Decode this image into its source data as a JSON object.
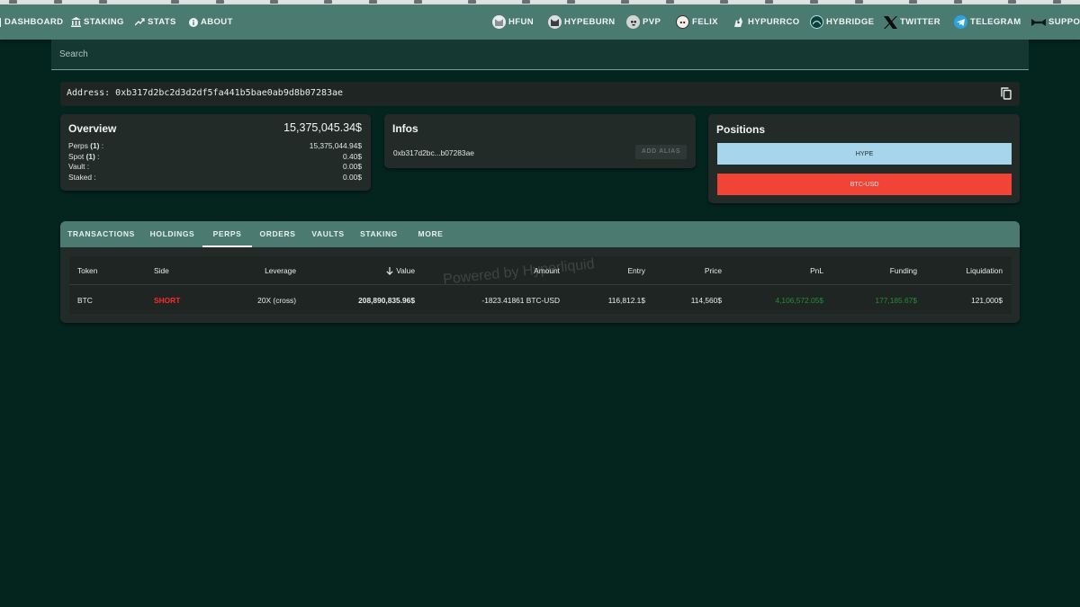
{
  "nav": {
    "left": [
      {
        "label": "DASHBOARD",
        "icon": "dashboard-icon"
      },
      {
        "label": "STAKING",
        "icon": "bank-icon"
      },
      {
        "label": "STATS",
        "icon": "trending-up-icon"
      },
      {
        "label": "ABOUT",
        "icon": "info-icon"
      }
    ],
    "right": [
      {
        "label": "HFUN",
        "icon": "cat-logo-icon"
      },
      {
        "label": "HYPEBURN",
        "icon": "cat-fire-icon"
      },
      {
        "label": "PVP",
        "icon": "skull-icon"
      },
      {
        "label": "FELIX",
        "icon": "felix-logo-icon"
      },
      {
        "label": "HYPURRCO",
        "icon": "hypurr-logo-icon"
      },
      {
        "label": "HYBRIDGE",
        "icon": "bridge-logo-icon"
      },
      {
        "label": "TWITTER",
        "icon": "x-logo-icon"
      },
      {
        "label": "TELEGRAM",
        "icon": "telegram-icon"
      },
      {
        "label": "SUPPORT",
        "icon": "support-icon"
      }
    ]
  },
  "search": {
    "label": "Search"
  },
  "address": {
    "text": "Address: 0xb317d2bc2d3d2df5fa441b5bae0ab9d8b07283ae"
  },
  "overview": {
    "title": "Overview",
    "total": "15,375,045.34$",
    "rows": [
      {
        "label": "Perps",
        "count": "(1)",
        "suffix": " :",
        "value": "15,375,044.94$"
      },
      {
        "label": "Spot",
        "count": "(1)",
        "suffix": " :",
        "value": "0.40$"
      },
      {
        "label": "Vault :",
        "count": "",
        "suffix": "",
        "value": "0.00$"
      },
      {
        "label": "Staked :",
        "count": "",
        "suffix": "",
        "value": "0.00$"
      }
    ]
  },
  "infos": {
    "title": "Infos",
    "address_short": "0xb317d2bc...b07283ae",
    "alias_label": "ADD ALIAS"
  },
  "positions": {
    "title": "Positions",
    "items": [
      {
        "label": "HYPE",
        "color": "#a7d6ec",
        "text_color": "#1f2a2c"
      },
      {
        "label": "BTC-USD",
        "color": "#f24436",
        "text_color": "#fbe9e7"
      }
    ]
  },
  "tabs": [
    "TRANSACTIONS",
    "HOLDINGS",
    "PERPS",
    "ORDERS",
    "VAULTS",
    "STAKING",
    "MORE"
  ],
  "active_tab": "PERPS",
  "table": {
    "columns": [
      "Token",
      "Side",
      "Leverage",
      "Value",
      "Amount",
      "Entry",
      "Price",
      "PnL",
      "Funding",
      "Liquidation"
    ],
    "rows": [
      {
        "token": "BTC",
        "side": "SHORT",
        "leverage": "20X (cross)",
        "value": "208,890,835.96$",
        "amount": "-1823.41861 BTC-USD",
        "entry": "116,812.1$",
        "price": "114,560$",
        "pnl": "4,106,572.05$",
        "funding": "177,185.67$",
        "liquidation": "121,000$"
      }
    ]
  },
  "watermark": "Powered by Hyperliquid",
  "colors": {
    "short": "#ff2a2a",
    "positive": "#1f8f33",
    "nav": "#4b7b70",
    "background": "#04241e"
  }
}
